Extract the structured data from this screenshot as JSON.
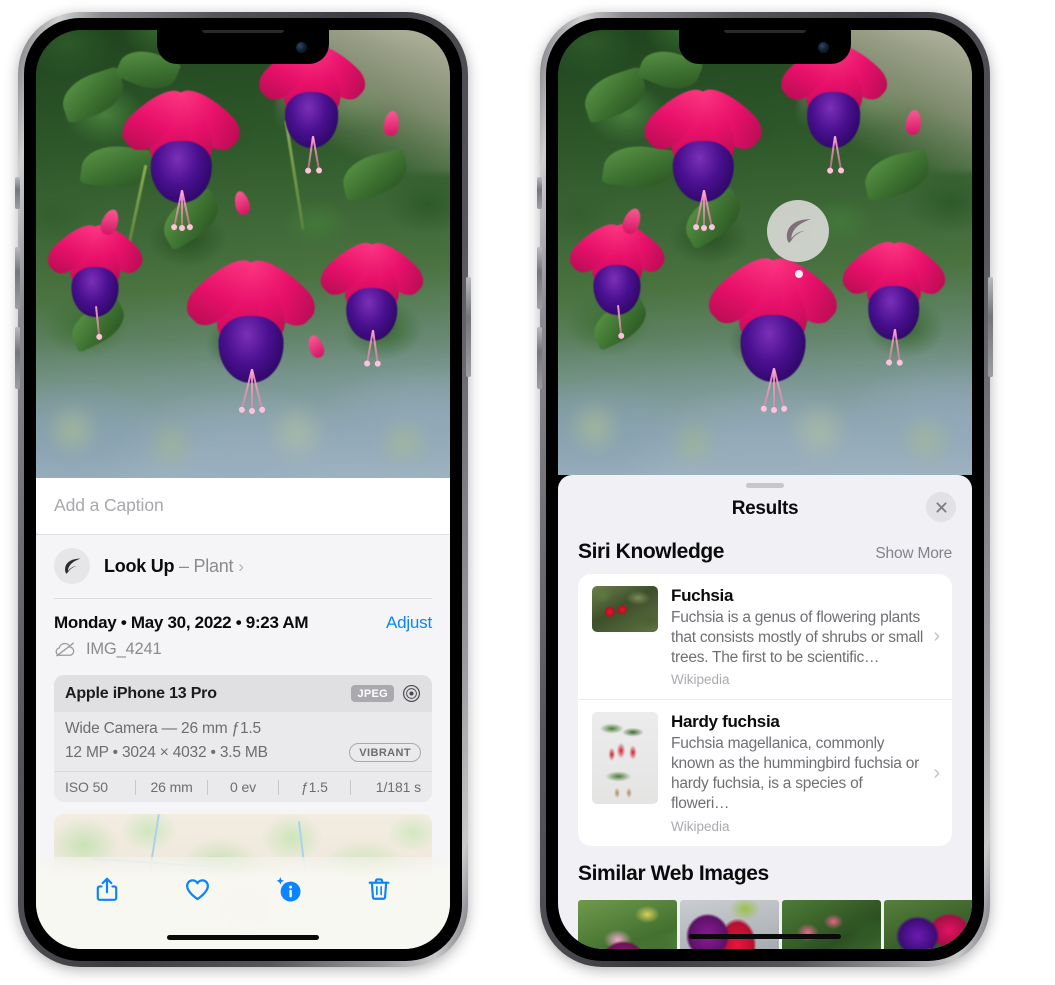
{
  "left_phone": {
    "photo": {
      "alt_name": "fuchsia-flowers-photo"
    },
    "caption": {
      "placeholder": "Add a Caption",
      "value": ""
    },
    "lookup": {
      "icon": "leaf-icon",
      "label": "Look Up",
      "dash": " – ",
      "subject": "Plant",
      "chevron": "›"
    },
    "details": {
      "date": "Monday • May 30, 2022 • 9:23 AM",
      "adjust_label": "Adjust",
      "cloud_icon": "cloud-slash-icon",
      "filename": "IMG_4241"
    },
    "camera_card": {
      "device": "Apple iPhone 13 Pro",
      "format_chip": "JPEG",
      "aperture_icon": "aperture-icon",
      "lens_line": "Wide Camera — 26 mm ƒ1.5",
      "spec_line": "12 MP • 3024 × 4032 • 3.5 MB",
      "style_chip": "VIBRANT",
      "exif": [
        "ISO 50",
        "26 mm",
        "0 ev",
        "ƒ1.5",
        "1/181 s"
      ]
    },
    "map": {
      "name": "location-map-preview",
      "pin": "photo-thumbnail-pin"
    },
    "toolbar": [
      {
        "name": "share-icon",
        "label": "Share"
      },
      {
        "name": "heart-icon",
        "label": "Favorite"
      },
      {
        "name": "info-sparkle-icon",
        "label": "Info"
      },
      {
        "name": "trash-icon",
        "label": "Delete"
      }
    ]
  },
  "right_phone": {
    "visual_lookup_badge": {
      "icon": "leaf-icon"
    },
    "sheet": {
      "grabber": "sheet-grabber",
      "title": "Results",
      "close_icon": "close-icon"
    },
    "siri_knowledge": {
      "title": "Siri Knowledge",
      "action": "Show More",
      "items": [
        {
          "title": "Fuchsia",
          "description": "Fuchsia is a genus of flowering plants that consists mostly of shrubs or small trees. The first to be scientific…",
          "source": "Wikipedia",
          "chevron": "›",
          "thumb": "fuchsia-red-flowers-thumbnail"
        },
        {
          "title": "Hardy fuchsia",
          "description": "Fuchsia magellanica, commonly known as the hummingbird fuchsia or hardy fuchsia, is a species of floweri…",
          "source": "Wikipedia",
          "chevron": "›",
          "thumb": "hardy-fuchsia-specimen-thumbnail"
        }
      ]
    },
    "similar_web_images": {
      "title": "Similar Web Images",
      "images": [
        "fuchsia-web-image-1",
        "fuchsia-web-image-2",
        "fuchsia-web-image-3",
        "fuchsia-web-image-4"
      ]
    }
  },
  "colors": {
    "accent_blue": "#0a84ff",
    "panel_bg": "#f5f5f7",
    "sheet_bg": "#f1f0f5",
    "card_bg": "#ffffff",
    "meta_card_bg": "#eaeaec",
    "secondary_text": "#8a8a8f"
  }
}
